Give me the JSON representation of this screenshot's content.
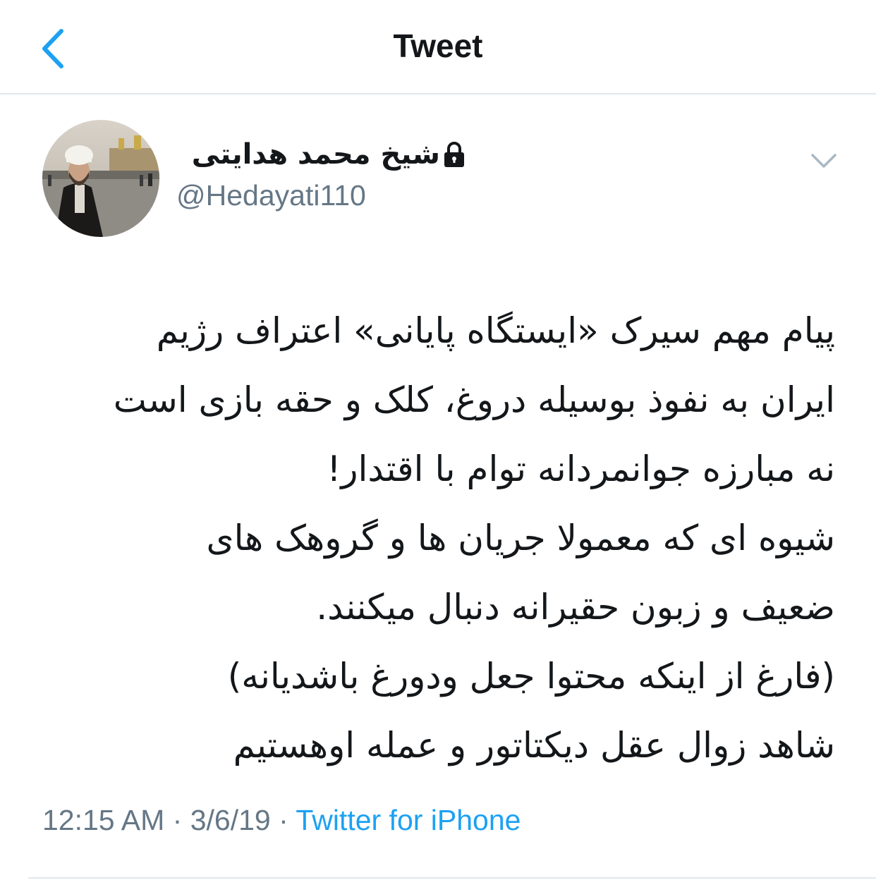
{
  "header": {
    "title": "Tweet",
    "back_icon": "chevron-left-icon",
    "accent_color": "#1da1f2"
  },
  "author": {
    "display_name": "شیخ محمد هدایتی",
    "handle": "@Hedayati110",
    "protected": true,
    "lock_icon": "lock-icon",
    "avatar": "avatar-photo"
  },
  "menu": {
    "caret_icon": "chevron-down-icon"
  },
  "tweet": {
    "lines": [
      "پیام مهم سیرک «ایستگاه پایانی» اعتراف رژیم",
      "ایران به نفوذ بوسیله دروغ، کلک و حقه بازی است",
      "نه مبارزه جوانمردانه توام با اقتدار!",
      "شیوه ای که معمولا جریان ها و گروهک های",
      "ضعیف و زبون حقیرانه دنبال میکنند.",
      "(فارغ از اینکه محتوا جعل ودورغ باشدیانه)",
      "شاهد زوال عقل دیکتاتور و عمله اوهستیم"
    ]
  },
  "meta": {
    "time": "12:15 AM",
    "separator": "·",
    "date": "3/6/19",
    "source": "Twitter for iPhone"
  }
}
